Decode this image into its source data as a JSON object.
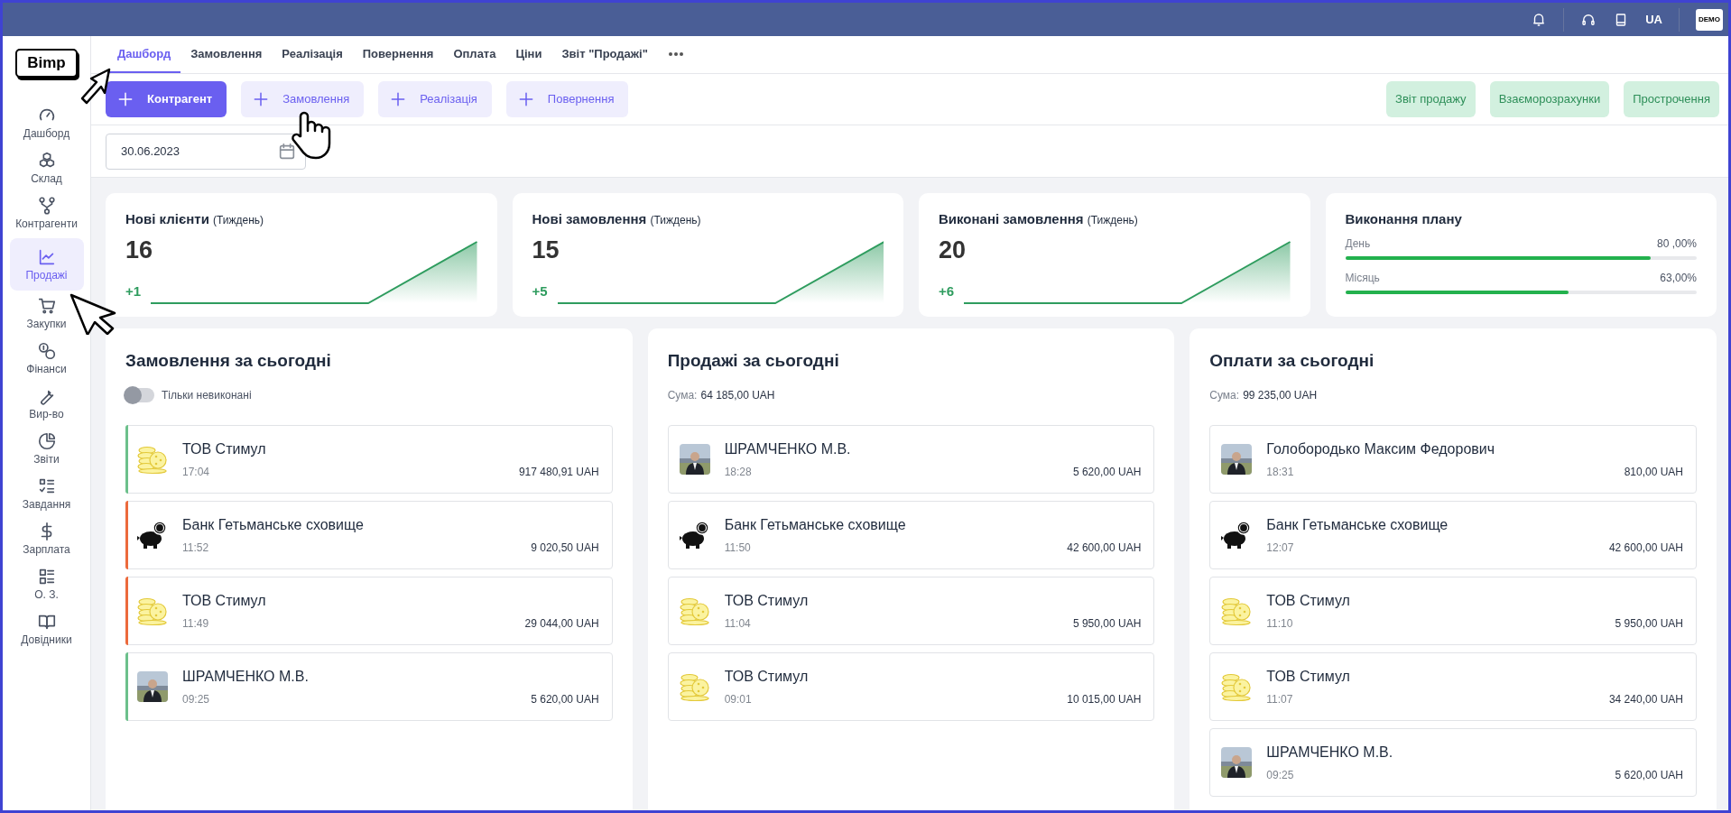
{
  "top_bar": {
    "language": "UA",
    "account_logo": "DEMO"
  },
  "sidebar": {
    "logo": "Bimp",
    "items": [
      {
        "label": "Дашборд",
        "selected": false
      },
      {
        "label": "Склад",
        "selected": false
      },
      {
        "label": "Контрагенти",
        "selected": false
      },
      {
        "label": "Продажі",
        "selected": true
      },
      {
        "label": "Закупки",
        "selected": false
      },
      {
        "label": "Фінанси",
        "selected": false
      },
      {
        "label": "Вир-во",
        "selected": false
      },
      {
        "label": "Звіти",
        "selected": false
      },
      {
        "label": "Завдання",
        "selected": false
      },
      {
        "label": "Зарплата",
        "selected": false
      },
      {
        "label": "О. З.",
        "selected": false
      },
      {
        "label": "Довідники",
        "selected": false
      }
    ]
  },
  "tabs": [
    {
      "label": "Дашборд",
      "selected": true
    },
    {
      "label": "Замовлення",
      "selected": false
    },
    {
      "label": "Реалізація",
      "selected": false
    },
    {
      "label": "Повернення",
      "selected": false
    },
    {
      "label": "Оплата",
      "selected": false
    },
    {
      "label": "Ціни",
      "selected": false
    },
    {
      "label": "Звіт \"Продажі\"",
      "selected": false
    }
  ],
  "create_buttons": [
    {
      "label": "Контрагент",
      "kind": "primary"
    },
    {
      "label": "Замовлення",
      "kind": "light"
    },
    {
      "label": "Реалізація",
      "kind": "light"
    },
    {
      "label": "Повернення",
      "kind": "light"
    }
  ],
  "report_buttons": [
    "Звіт продажу",
    "Взаєморозрахунки",
    "Прострочення"
  ],
  "date_field": {
    "value": "30.06.2023"
  },
  "kpi_cards": [
    {
      "title": "Нові клієнти",
      "period": "(Тиждень)",
      "value": "16",
      "delta": "+1"
    },
    {
      "title": "Нові замовлення",
      "period": "(Тиждень)",
      "value": "15",
      "delta": "+5"
    },
    {
      "title": "Виконані замовлення",
      "period": "(Тиждень)",
      "value": "20",
      "delta": "+6"
    }
  ],
  "plan_card": {
    "title": "Виконання плану",
    "rows": [
      {
        "label": "День",
        "reading": "80 ,00%",
        "level": 0.87
      },
      {
        "label": "Місяць",
        "reading": "63,00%",
        "level": 0.635
      }
    ]
  },
  "lists": [
    {
      "title": "Замовлення за сьогодні",
      "filter_toggle": {
        "label": "Тільки невиконані",
        "on": false
      },
      "entries": [
        {
          "name": "ТОВ Стимул",
          "time": "17:04",
          "amount": "917 480,91 UAH",
          "kind": "coins",
          "color": "#6cc08b"
        },
        {
          "name": "Банк Гетьманське сховище",
          "time": "11:52",
          "amount": "9 020,50 UAH",
          "kind": "piggy",
          "color": "#ec6a3c"
        },
        {
          "name": "ТОВ Стимул",
          "time": "11:49",
          "amount": "29 044,00 UAH",
          "kind": "coins",
          "color": "#ec6a3c"
        },
        {
          "name": "ШРАМЧЕНКО М.В.",
          "time": "09:25",
          "amount": "5 620,00 UAH",
          "kind": "picture",
          "color": "#6cc08b"
        }
      ]
    },
    {
      "title": "Продажі за сьогодні",
      "sum_label": "Сума:",
      "sum": "64 185,00 UAH",
      "entries": [
        {
          "name": "ШРАМЧЕНКО М.В.",
          "time": "18:28",
          "amount": "5 620,00 UAH",
          "kind": "picture"
        },
        {
          "name": "Банк Гетьманське сховище",
          "time": "11:50",
          "amount": "42 600,00 UAH",
          "kind": "piggy"
        },
        {
          "name": "ТОВ Стимул",
          "time": "11:04",
          "amount": "5 950,00 UAH",
          "kind": "coins"
        },
        {
          "name": "ТОВ Стимул",
          "time": "09:01",
          "amount": "10 015,00 UAH",
          "kind": "coins"
        }
      ]
    },
    {
      "title": "Оплати за сьогодні",
      "sum_label": "Сума:",
      "sum": "99 235,00 UAH",
      "entries": [
        {
          "name": "Голобородько Максим Федорович",
          "time": "18:31",
          "amount": "810,00 UAH",
          "kind": "picture"
        },
        {
          "name": "Банк Гетьманське сховище",
          "time": "12:07",
          "amount": "42 600,00 UAH",
          "kind": "piggy"
        },
        {
          "name": "ТОВ Стимул",
          "time": "11:10",
          "amount": "5 950,00 UAH",
          "kind": "coins"
        },
        {
          "name": "ТОВ Стимул",
          "time": "11:07",
          "amount": "34 240,00 UAH",
          "kind": "coins"
        },
        {
          "name": "ШРАМЧЕНКО М.В.",
          "time": "09:25",
          "amount": "5 620,00 UAH",
          "kind": "picture"
        }
      ]
    }
  ]
}
